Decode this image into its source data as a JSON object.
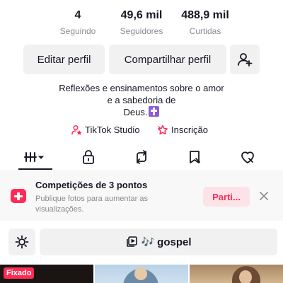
{
  "stats": [
    {
      "value": "4",
      "label": "Seguindo"
    },
    {
      "value": "49,6 mil",
      "label": "Seguidores"
    },
    {
      "value": "488,9 mil",
      "label": "Curtidas"
    }
  ],
  "actions": {
    "edit_label": "Editar perfil",
    "share_label": "Compartilhar perfil",
    "add_friend_icon": "add-person-icon"
  },
  "bio": {
    "line1": "Reflexões e ensinamentos sobre o amor",
    "line2": "e a sabedoria de",
    "line3": "Deus.",
    "emoji_icon": "latin-cross-icon"
  },
  "links": {
    "studio_label": "TikTok Studio",
    "subscription_label": "Inscrição"
  },
  "tabs": [
    {
      "icon": "grid-icon",
      "active": true
    },
    {
      "icon": "lock-icon",
      "active": false
    },
    {
      "icon": "repost-icon",
      "active": false
    },
    {
      "icon": "bookmark-icon",
      "active": false
    },
    {
      "icon": "heart-icon",
      "active": false
    }
  ],
  "promo": {
    "title": "Competições de 3 pontos",
    "subtitle": "Publique fotos para aumentar as visualizações.",
    "button_label": "Parti...",
    "accent_color": "#fe2c55"
  },
  "filters": {
    "tag_label": "gospel",
    "tag_emoji": "🎶"
  },
  "videos": [
    {
      "badge": "Fixado"
    },
    {
      "badge": ""
    },
    {
      "badge": ""
    }
  ]
}
